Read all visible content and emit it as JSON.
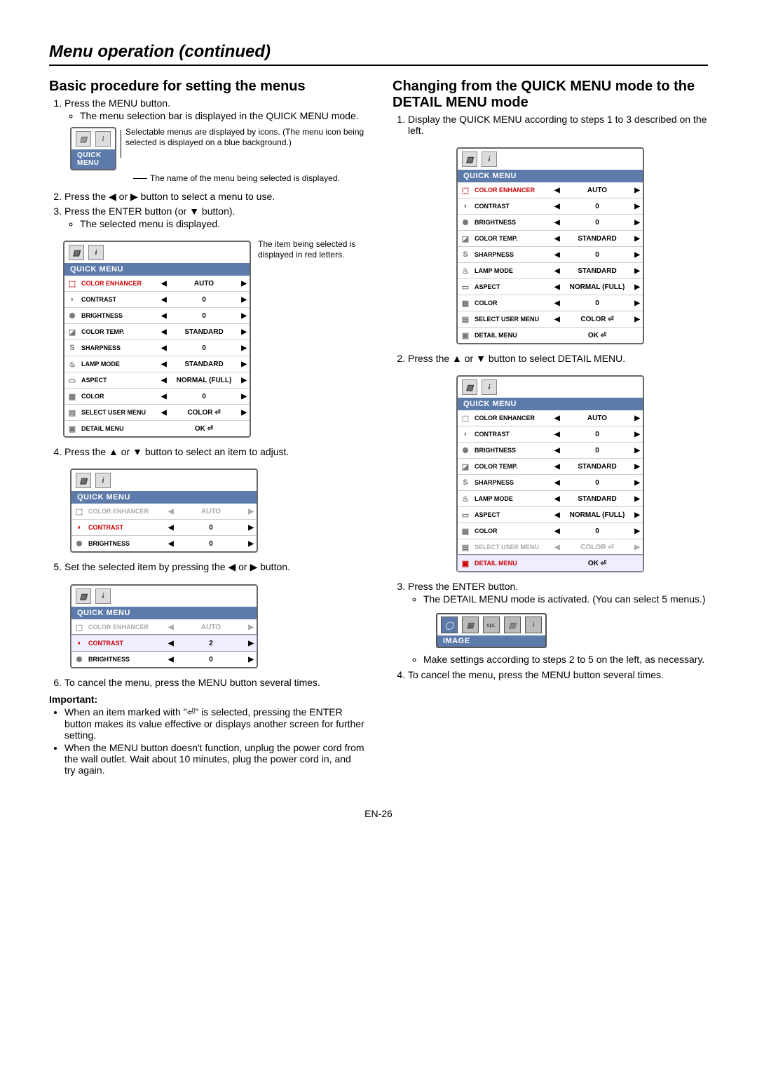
{
  "page_title": "Menu operation (continued)",
  "page_number": "EN-26",
  "left": {
    "heading": "Basic procedure for setting the menus",
    "step1": "Press the MENU button.",
    "step1_bullet": "The menu selection bar is displayed in the QUICK MENU mode.",
    "diagram1_top": "Selectable menus are displayed by icons. (The menu icon being selected is displayed on a blue background.)",
    "diagram1_header": "QUICK MENU",
    "diagram1_bottom": "The name of the menu being selected is displayed.",
    "step2": "Press the ◀ or ▶ button to select a menu to use.",
    "step3": "Press the ENTER button (or ▼ button).",
    "step3_bullet": "The selected menu is displayed.",
    "fig2_caption": "The item being selected is displayed in red letters.",
    "step4": "Press the ▲ or ▼ button to select an item to adjust.",
    "step5": "Set the selected item by pressing the ◀ or ▶ button.",
    "step6": "To cancel the menu, press the MENU button several times.",
    "important_label": "Important:",
    "important_b1": "When an item marked with \"⏎\" is selected, pressing the ENTER button makes its value effective or displays another screen for further setting.",
    "important_b2": "When the MENU button doesn't function, unplug the power cord from the wall outlet. Wait about 10 minutes, plug the power cord in, and try again."
  },
  "right": {
    "heading": "Changing from the QUICK MENU mode to the DETAIL MENU mode",
    "step1": "Display the QUICK MENU according to steps 1 to 3 described on the left.",
    "step2": "Press the ▲ or ▼ button to select DETAIL MENU.",
    "step3": "Press the ENTER button.",
    "step3_bullet": "The DETAIL MENU mode is activated. (You can select 5 menus.)",
    "detail_bar_label": "IMAGE",
    "detail_bar_opt": "opt.",
    "step3_bullet2": "Make settings according to steps 2 to 5 on the left, as necessary.",
    "step4": "To cancel the menu, press the MENU button several times."
  },
  "osd": {
    "header": "QUICK MENU",
    "rows": [
      {
        "label": "COLOR\nENHANCER",
        "value": "AUTO",
        "arrows": true
      },
      {
        "label": "CONTRAST",
        "value": "0",
        "arrows": true
      },
      {
        "label": "BRIGHTNESS",
        "value": "0",
        "arrows": true
      },
      {
        "label": "COLOR TEMP.",
        "value": "STANDARD",
        "arrows": true
      },
      {
        "label": "SHARPNESS",
        "value": "0",
        "arrows": true
      },
      {
        "label": "LAMP MODE",
        "value": "STANDARD",
        "arrows": true
      },
      {
        "label": "ASPECT",
        "value": "NORMAL (FULL)",
        "arrows": true
      },
      {
        "label": "COLOR",
        "value": "0",
        "arrows": true
      },
      {
        "label": "SELECT\nUSER MENU",
        "value": "COLOR ⏎",
        "arrows": true
      },
      {
        "label": "DETAIL MENU",
        "value": "OK ⏎",
        "arrows": false
      }
    ],
    "partial3": [
      {
        "label": "COLOR\nENHANCER",
        "value": "AUTO"
      },
      {
        "label": "CONTRAST",
        "value": "0"
      },
      {
        "label": "BRIGHTNESS",
        "value": "0"
      }
    ],
    "step5rows": [
      {
        "label": "COLOR\nENHANCER",
        "value": "AUTO"
      },
      {
        "label": "CONTRAST",
        "value": "2"
      },
      {
        "label": "BRIGHTNESS",
        "value": "0"
      }
    ]
  }
}
